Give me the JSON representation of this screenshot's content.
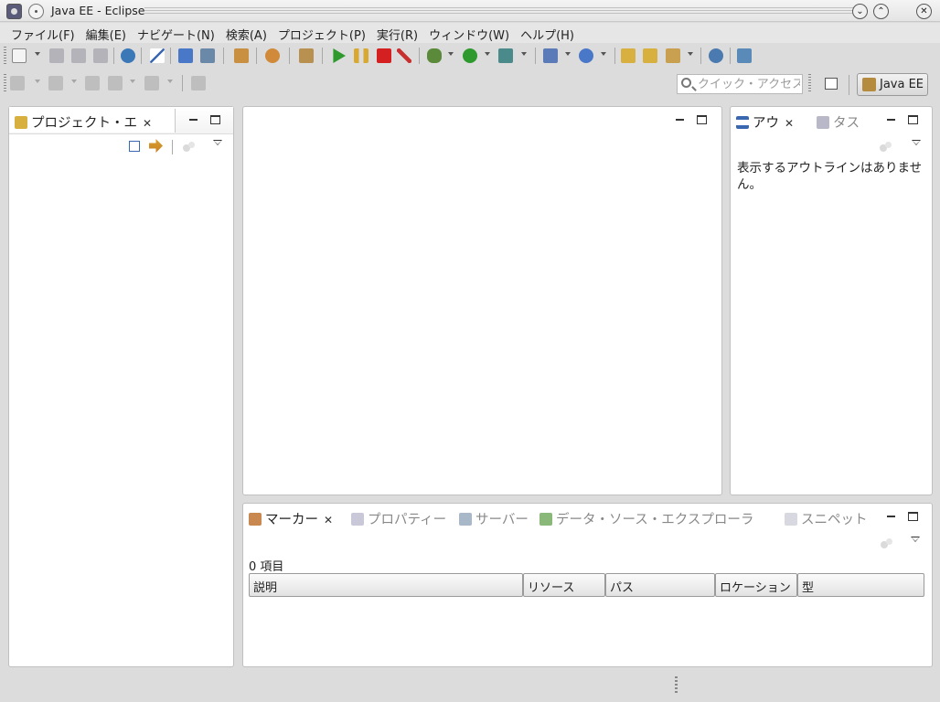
{
  "window": {
    "title": "Java EE - Eclipse"
  },
  "menubar": {
    "items": [
      "ファイル(F)",
      "編集(E)",
      "ナビゲート(N)",
      "検索(A)",
      "プロジェクト(P)",
      "実行(R)",
      "ウィンドウ(W)",
      "ヘルプ(H)"
    ]
  },
  "toolbar": {
    "quick_access_placeholder": "クイック・アクセス",
    "perspective_label": "Java EE"
  },
  "project_explorer": {
    "tab_label": "プロジェクト・エ"
  },
  "outline": {
    "tab_label": "アウ",
    "tasks_tab_label": "タス",
    "empty_message": "表示するアウトラインはありません。"
  },
  "bottom_panel": {
    "tabs": [
      "マーカー",
      "プロパティー",
      "サーバー",
      "データ・ソース・エクスプローラ",
      "スニペット"
    ],
    "item_count": "0 項目",
    "columns": [
      "説明",
      "リソース",
      "パス",
      "ロケーション",
      "型"
    ]
  },
  "colors": {
    "background": "#dcdcdc",
    "panel": "#ffffff",
    "stop_red": "#d42020",
    "run_green": "#2e9a2e"
  }
}
